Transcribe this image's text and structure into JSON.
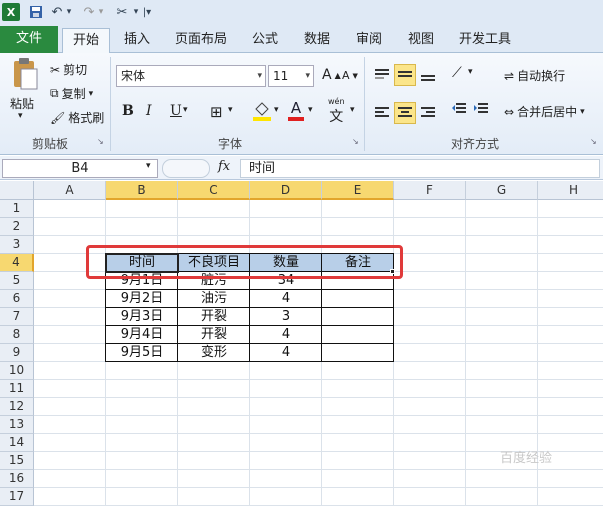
{
  "qat": {
    "dropdown_glyph": "▾",
    "more_glyph": "|▾"
  },
  "tabs": [
    "文件",
    "开始",
    "插入",
    "页面布局",
    "公式",
    "数据",
    "审阅",
    "视图",
    "开发工具"
  ],
  "ribbon": {
    "clipboard": {
      "paste": "粘贴",
      "cut": "剪切",
      "copy": "复制",
      "format_painter": "格式刷",
      "label": "剪贴板"
    },
    "font": {
      "name": "宋体",
      "size": "11",
      "bold": "B",
      "italic": "I",
      "underline": "U",
      "label": "字体",
      "grow": "A",
      "shrink": "A",
      "font_color": "A",
      "phonetic": "wén",
      "phonetic_char": "文"
    },
    "align": {
      "wrap": "自动换行",
      "merge": "合并后居中",
      "label": "对齐方式"
    }
  },
  "formula_bar": {
    "name_box": "B4",
    "fx": "fx",
    "content": "时间"
  },
  "sheet": {
    "columns": [
      "A",
      "B",
      "C",
      "D",
      "E",
      "F",
      "G",
      "H"
    ],
    "rows": [
      "1",
      "2",
      "3",
      "4",
      "5",
      "6",
      "7",
      "8",
      "9",
      "10",
      "11",
      "12",
      "13",
      "14",
      "15",
      "16",
      "17"
    ],
    "header": [
      "时间",
      "不良项目",
      "数量",
      "备注"
    ],
    "data": [
      [
        "9月1日",
        "脏污",
        "34",
        ""
      ],
      [
        "9月2日",
        "油污",
        "4",
        ""
      ],
      [
        "9月3日",
        "开裂",
        "3",
        ""
      ],
      [
        "9月4日",
        "开裂",
        "4",
        ""
      ],
      [
        "9月5日",
        "变形",
        "4",
        ""
      ]
    ]
  },
  "watermark": "百度经验",
  "colors": {
    "file_tab": "#2a8a3f",
    "selection": "#b8cfe8",
    "highlight_box": "#e03a3a",
    "header_highlight": "#f7d870"
  }
}
